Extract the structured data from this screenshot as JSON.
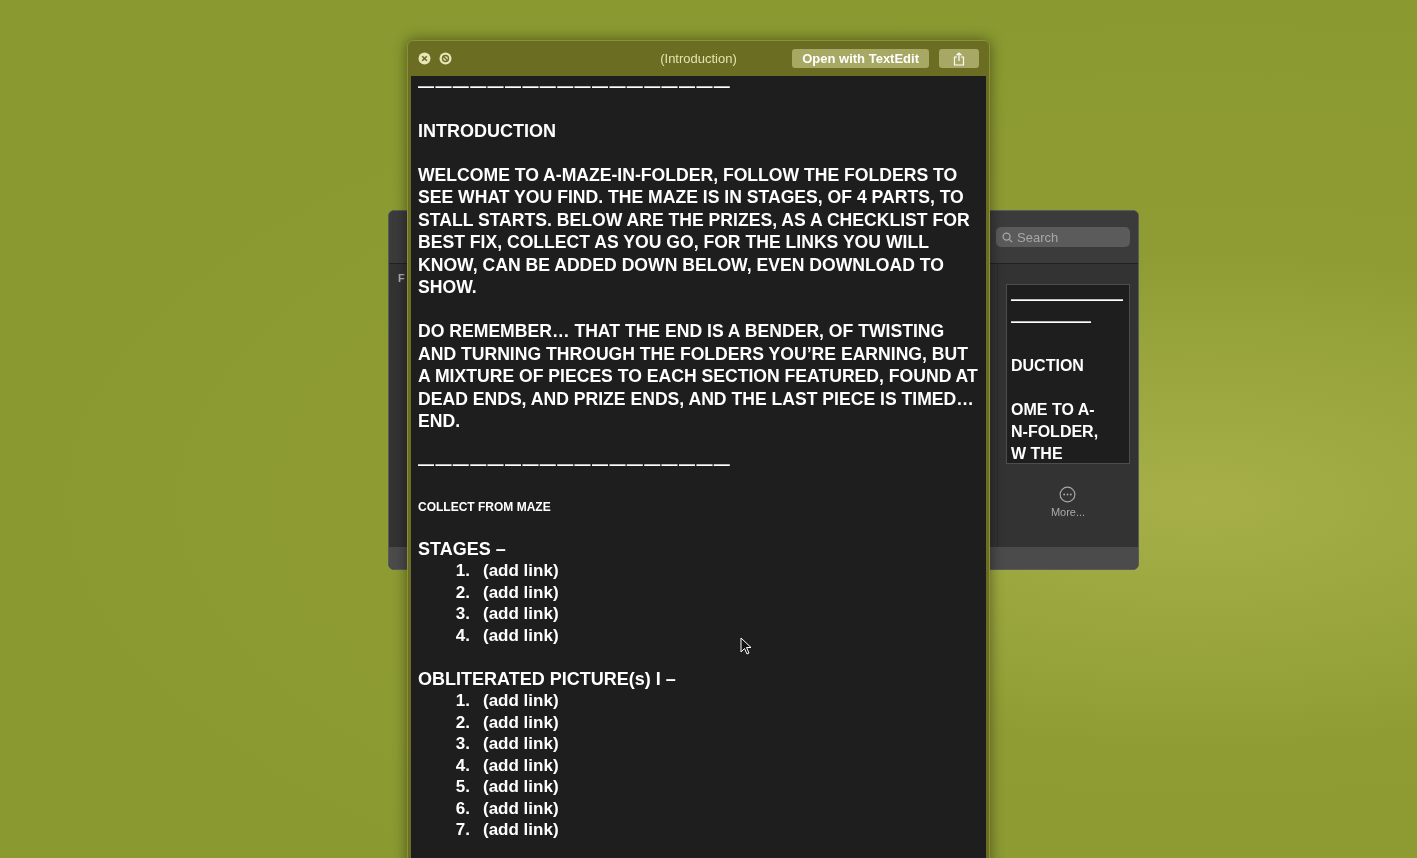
{
  "background_window": {
    "sidebar_label": "F",
    "search": {
      "placeholder": "Search"
    },
    "preview_paragraphs": [
      [
        "———————",
        "—————"
      ],
      [
        "DUCTION"
      ],
      [
        "OME TO A-",
        "N-FOLDER,",
        "W THE"
      ]
    ],
    "more_button": "More..."
  },
  "window": {
    "title": "(Introduction)",
    "open_button": "Open with TextEdit"
  },
  "document": [
    {
      "kind": "rule",
      "text": "——————————————————"
    },
    {
      "kind": "heading",
      "text": "INTRODUCTION"
    },
    {
      "kind": "paragraph",
      "text": "WELCOME TO A-MAZE-IN-FOLDER, FOLLOW THE FOLDERS TO SEE WHAT YOU FIND. THE MAZE IS IN STAGES, OF 4 PARTS, TO STALL STARTS. BELOW ARE THE PRIZES, AS A CHECKLIST FOR BEST FIX, COLLECT AS YOU GO, FOR THE LINKS YOU WILL KNOW, CAN BE ADDED DOWN BELOW, EVEN DOWNLOAD TO SHOW."
    },
    {
      "kind": "paragraph",
      "text": "DO REMEMBER… THAT THE END IS A BENDER, OF TWISTING AND TURNING THROUGH THE FOLDERS YOU’RE EARNING, BUT A MIXTURE OF PIECES TO EACH SECTION FEATURED, FOUND AT DEAD ENDS, AND PRIZE ENDS, AND THE LAST PIECE IS TIMED… END."
    },
    {
      "kind": "rule",
      "text": "——————————————————"
    },
    {
      "kind": "small_heading",
      "text": "COLLECT FROM MAZE"
    },
    {
      "kind": "list",
      "title": "STAGES –",
      "items": [
        {
          "number": "1.",
          "text": "(add link)"
        },
        {
          "number": "2.",
          "text": "(add link)"
        },
        {
          "number": "3.",
          "text": "(add link)"
        },
        {
          "number": "4.",
          "text": "(add link)"
        }
      ]
    },
    {
      "kind": "list",
      "title": "OBLITERATED PICTURE(s) I –",
      "items": [
        {
          "number": "1.",
          "text": "(add link)"
        },
        {
          "number": "2.",
          "text": "(add link)"
        },
        {
          "number": "3.",
          "text": "(add link)"
        },
        {
          "number": "4.",
          "text": "(add link)"
        },
        {
          "number": "5.",
          "text": "(add link)"
        },
        {
          "number": "6.",
          "text": "(add link)"
        },
        {
          "number": "7.",
          "text": "(add link)"
        }
      ]
    }
  ]
}
